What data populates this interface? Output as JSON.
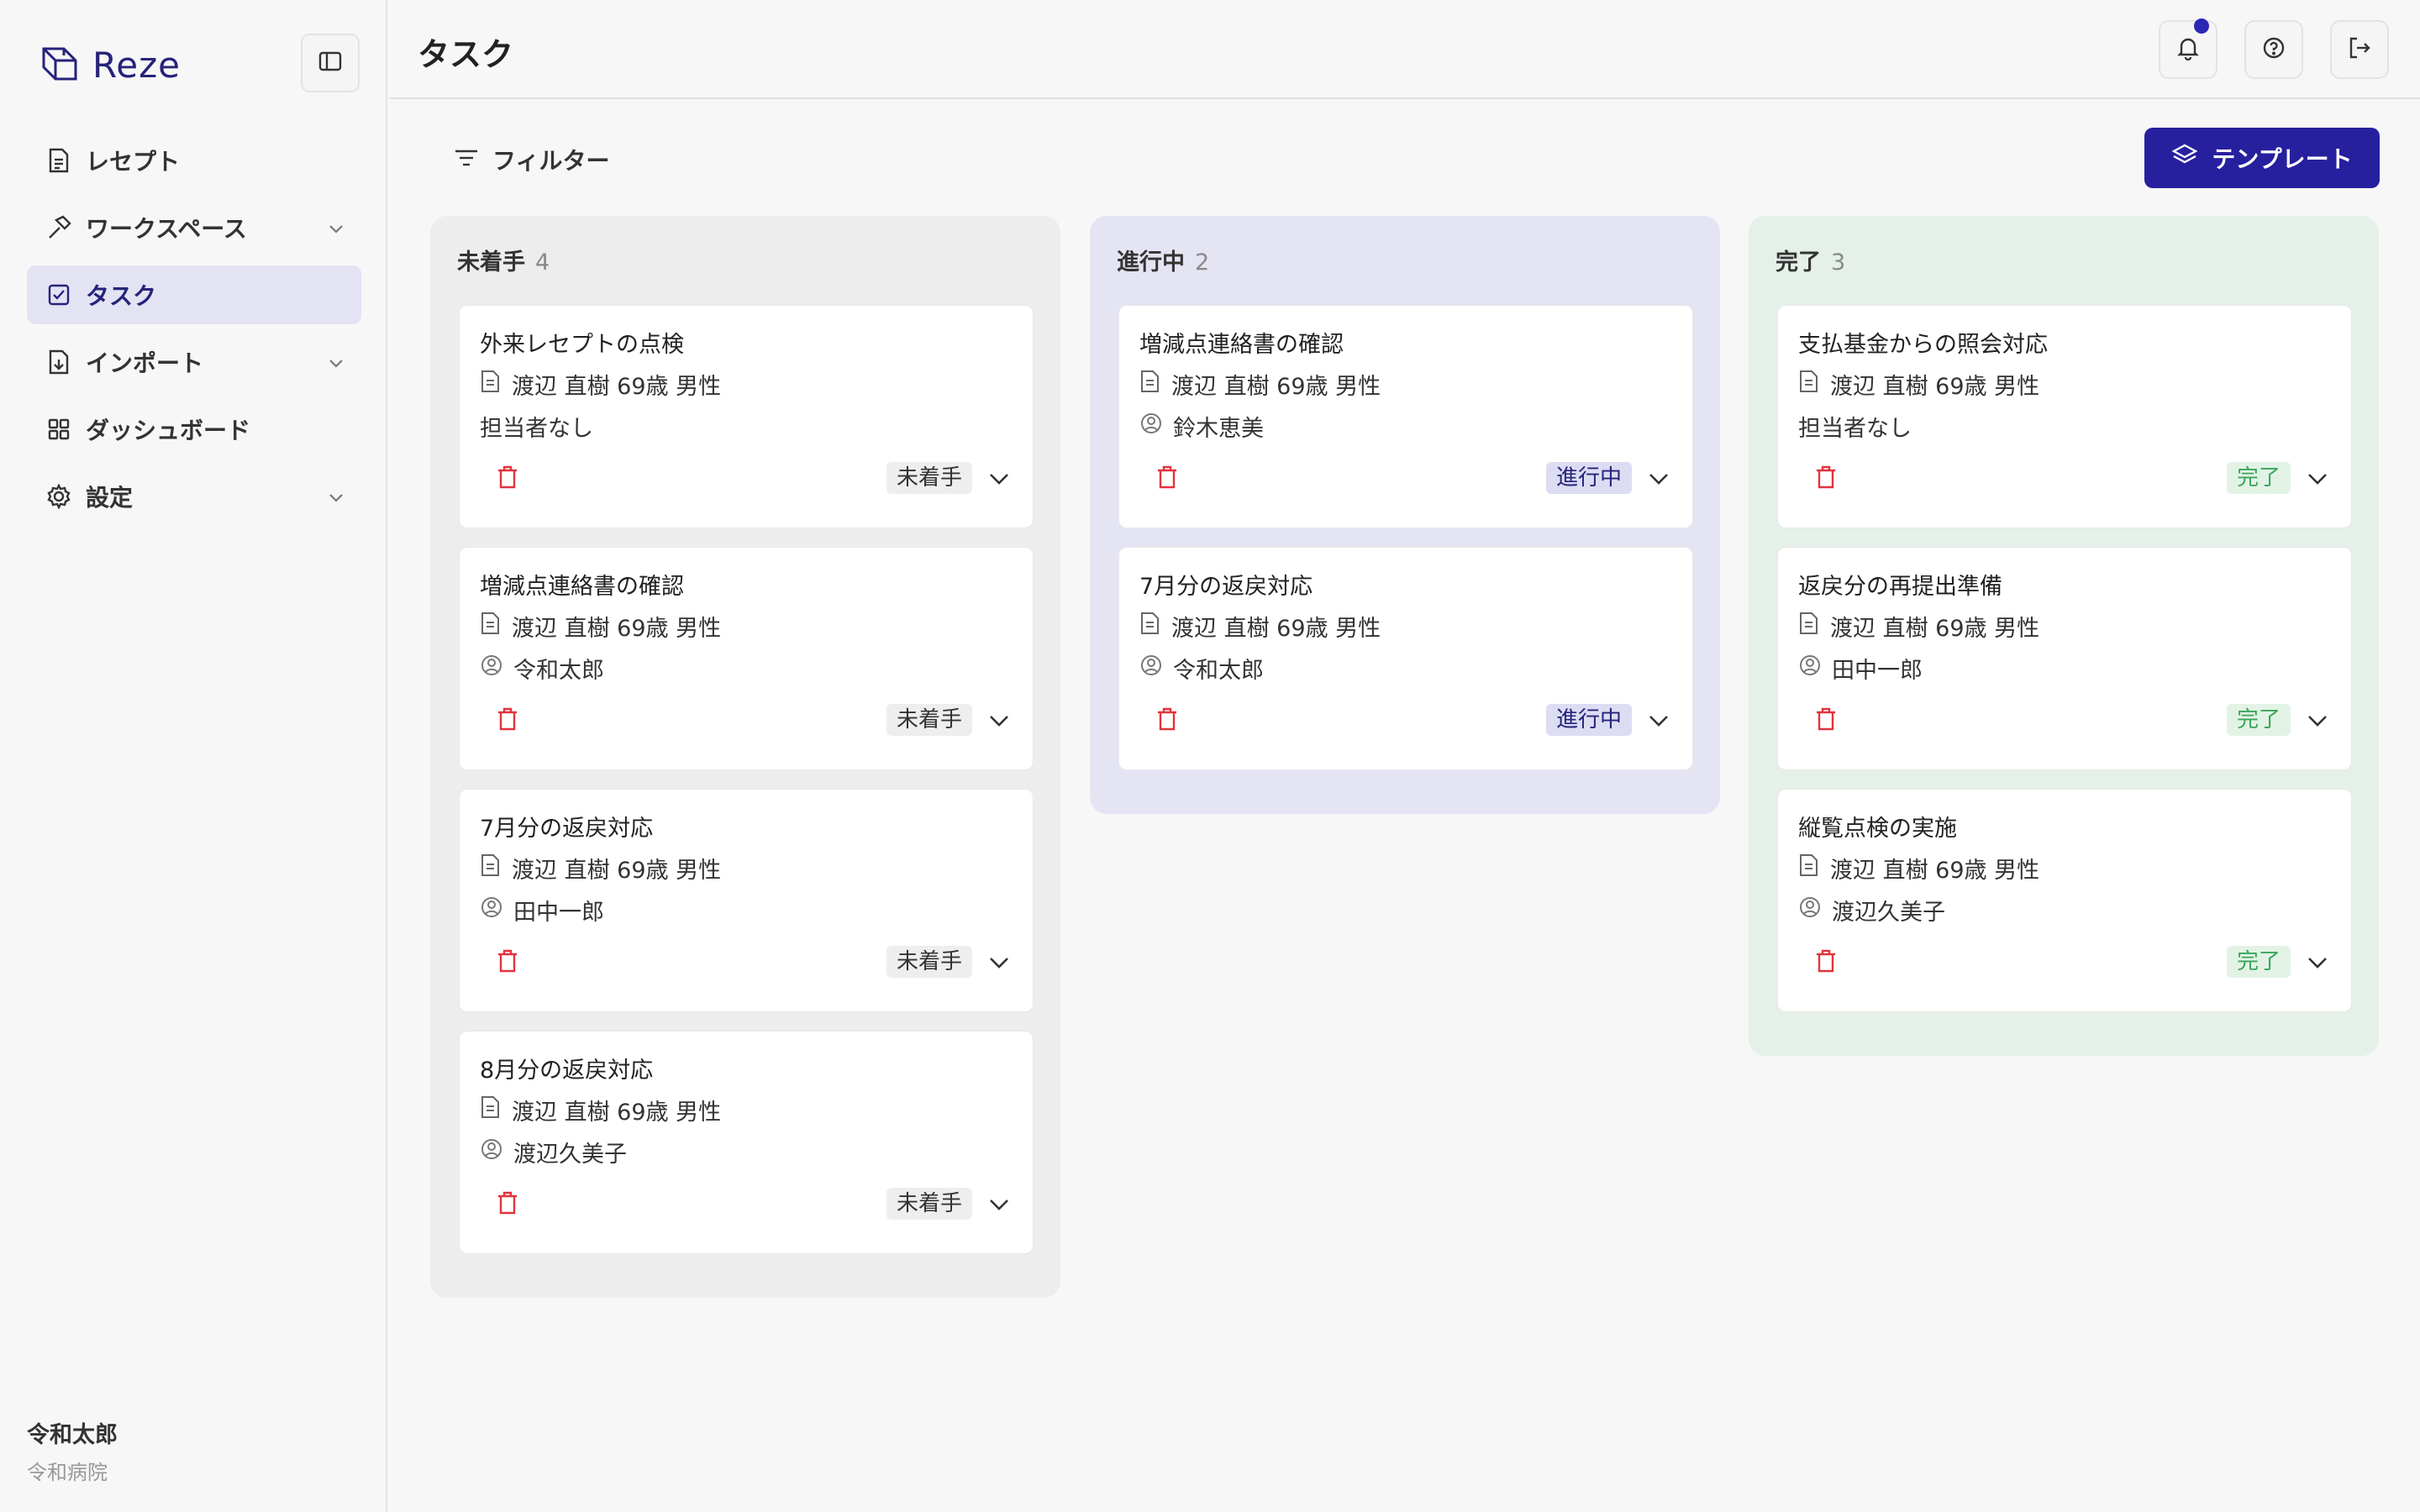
{
  "app": {
    "name": "Reze"
  },
  "sidebar": {
    "items": [
      {
        "label": "レセプト",
        "icon": "document-icon",
        "active": false,
        "expandable": false
      },
      {
        "label": "ワークスペース",
        "icon": "hammer-icon",
        "active": false,
        "expandable": true
      },
      {
        "label": "タスク",
        "icon": "checkbox-icon",
        "active": true,
        "expandable": false
      },
      {
        "label": "インポート",
        "icon": "file-import-icon",
        "active": false,
        "expandable": true
      },
      {
        "label": "ダッシュボード",
        "icon": "grid-icon",
        "active": false,
        "expandable": false
      },
      {
        "label": "設定",
        "icon": "gear-icon",
        "active": false,
        "expandable": true
      }
    ]
  },
  "user": {
    "name": "令和太郎",
    "org": "令和病院"
  },
  "header": {
    "title": "タスク"
  },
  "toolbar": {
    "filter_label": "フィルター",
    "template_label": "テンプレート"
  },
  "colors": {
    "accent": "#26209f",
    "danger": "#e0343e",
    "done": "#3aa55a"
  },
  "columns": [
    {
      "title": "未着手",
      "count": "4",
      "cards": [
        {
          "title": "外来レセプトの点検",
          "patient": "渡辺 直樹  69歳  男性",
          "assignee": "担当者なし",
          "has_avatar": false,
          "status": "未着手"
        },
        {
          "title": "増減点連絡書の確認",
          "patient": "渡辺 直樹  69歳  男性",
          "assignee": "令和太郎",
          "has_avatar": true,
          "status": "未着手"
        },
        {
          "title": "7月分の返戻対応",
          "patient": "渡辺 直樹  69歳  男性",
          "assignee": "田中一郎",
          "has_avatar": true,
          "status": "未着手"
        },
        {
          "title": "8月分の返戻対応",
          "patient": "渡辺 直樹  69歳  男性",
          "assignee": "渡辺久美子",
          "has_avatar": true,
          "status": "未着手"
        }
      ]
    },
    {
      "title": "進行中",
      "count": "2",
      "cards": [
        {
          "title": "増減点連絡書の確認",
          "patient": "渡辺 直樹  69歳  男性",
          "assignee": "鈴木恵美",
          "has_avatar": true,
          "status": "進行中"
        },
        {
          "title": "7月分の返戻対応",
          "patient": "渡辺 直樹  69歳  男性",
          "assignee": "令和太郎",
          "has_avatar": true,
          "status": "進行中"
        }
      ]
    },
    {
      "title": "完了",
      "count": "3",
      "cards": [
        {
          "title": "支払基金からの照会対応",
          "patient": "渡辺 直樹  69歳  男性",
          "assignee": "担当者なし",
          "has_avatar": false,
          "status": "完了"
        },
        {
          "title": "返戻分の再提出準備",
          "patient": "渡辺 直樹  69歳  男性",
          "assignee": "田中一郎",
          "has_avatar": true,
          "status": "完了"
        },
        {
          "title": "縦覧点検の実施",
          "patient": "渡辺 直樹  69歳  男性",
          "assignee": "渡辺久美子",
          "has_avatar": true,
          "status": "完了"
        }
      ]
    }
  ]
}
